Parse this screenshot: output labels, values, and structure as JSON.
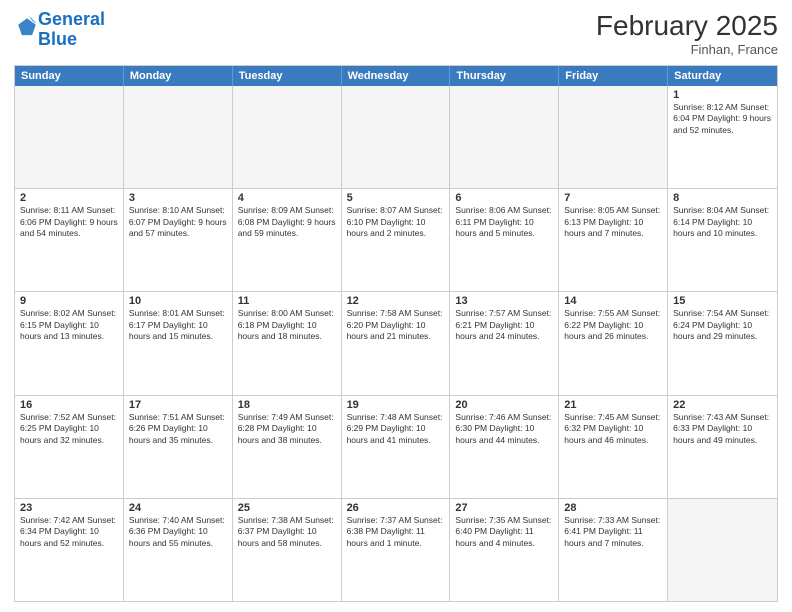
{
  "header": {
    "logo_line1": "General",
    "logo_line2": "Blue",
    "month": "February 2025",
    "location": "Finhan, France"
  },
  "days_of_week": [
    "Sunday",
    "Monday",
    "Tuesday",
    "Wednesday",
    "Thursday",
    "Friday",
    "Saturday"
  ],
  "weeks": [
    [
      {
        "day": "",
        "info": ""
      },
      {
        "day": "",
        "info": ""
      },
      {
        "day": "",
        "info": ""
      },
      {
        "day": "",
        "info": ""
      },
      {
        "day": "",
        "info": ""
      },
      {
        "day": "",
        "info": ""
      },
      {
        "day": "1",
        "info": "Sunrise: 8:12 AM\nSunset: 6:04 PM\nDaylight: 9 hours and 52 minutes."
      }
    ],
    [
      {
        "day": "2",
        "info": "Sunrise: 8:11 AM\nSunset: 6:06 PM\nDaylight: 9 hours and 54 minutes."
      },
      {
        "day": "3",
        "info": "Sunrise: 8:10 AM\nSunset: 6:07 PM\nDaylight: 9 hours and 57 minutes."
      },
      {
        "day": "4",
        "info": "Sunrise: 8:09 AM\nSunset: 6:08 PM\nDaylight: 9 hours and 59 minutes."
      },
      {
        "day": "5",
        "info": "Sunrise: 8:07 AM\nSunset: 6:10 PM\nDaylight: 10 hours and 2 minutes."
      },
      {
        "day": "6",
        "info": "Sunrise: 8:06 AM\nSunset: 6:11 PM\nDaylight: 10 hours and 5 minutes."
      },
      {
        "day": "7",
        "info": "Sunrise: 8:05 AM\nSunset: 6:13 PM\nDaylight: 10 hours and 7 minutes."
      },
      {
        "day": "8",
        "info": "Sunrise: 8:04 AM\nSunset: 6:14 PM\nDaylight: 10 hours and 10 minutes."
      }
    ],
    [
      {
        "day": "9",
        "info": "Sunrise: 8:02 AM\nSunset: 6:15 PM\nDaylight: 10 hours and 13 minutes."
      },
      {
        "day": "10",
        "info": "Sunrise: 8:01 AM\nSunset: 6:17 PM\nDaylight: 10 hours and 15 minutes."
      },
      {
        "day": "11",
        "info": "Sunrise: 8:00 AM\nSunset: 6:18 PM\nDaylight: 10 hours and 18 minutes."
      },
      {
        "day": "12",
        "info": "Sunrise: 7:58 AM\nSunset: 6:20 PM\nDaylight: 10 hours and 21 minutes."
      },
      {
        "day": "13",
        "info": "Sunrise: 7:57 AM\nSunset: 6:21 PM\nDaylight: 10 hours and 24 minutes."
      },
      {
        "day": "14",
        "info": "Sunrise: 7:55 AM\nSunset: 6:22 PM\nDaylight: 10 hours and 26 minutes."
      },
      {
        "day": "15",
        "info": "Sunrise: 7:54 AM\nSunset: 6:24 PM\nDaylight: 10 hours and 29 minutes."
      }
    ],
    [
      {
        "day": "16",
        "info": "Sunrise: 7:52 AM\nSunset: 6:25 PM\nDaylight: 10 hours and 32 minutes."
      },
      {
        "day": "17",
        "info": "Sunrise: 7:51 AM\nSunset: 6:26 PM\nDaylight: 10 hours and 35 minutes."
      },
      {
        "day": "18",
        "info": "Sunrise: 7:49 AM\nSunset: 6:28 PM\nDaylight: 10 hours and 38 minutes."
      },
      {
        "day": "19",
        "info": "Sunrise: 7:48 AM\nSunset: 6:29 PM\nDaylight: 10 hours and 41 minutes."
      },
      {
        "day": "20",
        "info": "Sunrise: 7:46 AM\nSunset: 6:30 PM\nDaylight: 10 hours and 44 minutes."
      },
      {
        "day": "21",
        "info": "Sunrise: 7:45 AM\nSunset: 6:32 PM\nDaylight: 10 hours and 46 minutes."
      },
      {
        "day": "22",
        "info": "Sunrise: 7:43 AM\nSunset: 6:33 PM\nDaylight: 10 hours and 49 minutes."
      }
    ],
    [
      {
        "day": "23",
        "info": "Sunrise: 7:42 AM\nSunset: 6:34 PM\nDaylight: 10 hours and 52 minutes."
      },
      {
        "day": "24",
        "info": "Sunrise: 7:40 AM\nSunset: 6:36 PM\nDaylight: 10 hours and 55 minutes."
      },
      {
        "day": "25",
        "info": "Sunrise: 7:38 AM\nSunset: 6:37 PM\nDaylight: 10 hours and 58 minutes."
      },
      {
        "day": "26",
        "info": "Sunrise: 7:37 AM\nSunset: 6:38 PM\nDaylight: 11 hours and 1 minute."
      },
      {
        "day": "27",
        "info": "Sunrise: 7:35 AM\nSunset: 6:40 PM\nDaylight: 11 hours and 4 minutes."
      },
      {
        "day": "28",
        "info": "Sunrise: 7:33 AM\nSunset: 6:41 PM\nDaylight: 11 hours and 7 minutes."
      },
      {
        "day": "",
        "info": ""
      }
    ]
  ]
}
